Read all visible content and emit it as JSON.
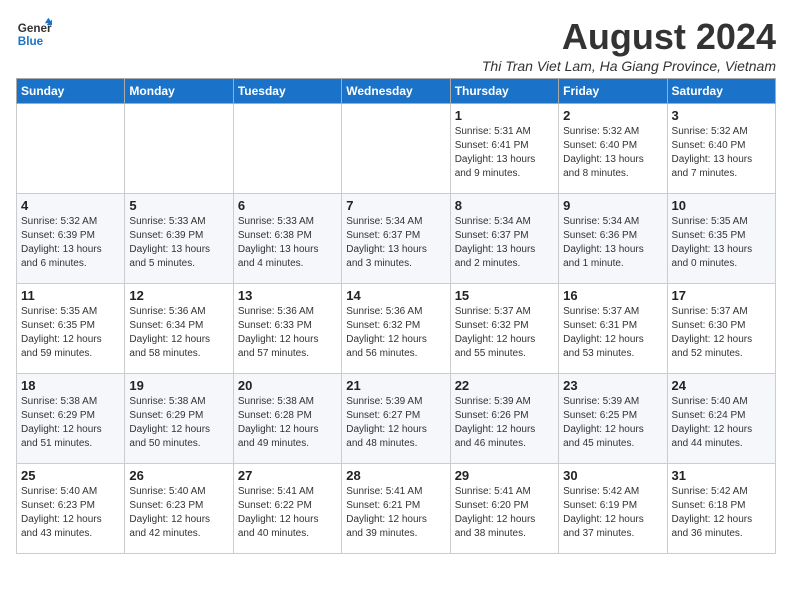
{
  "header": {
    "logo_line1": "General",
    "logo_line2": "Blue",
    "month_title": "August 2024",
    "subtitle": "Thi Tran Viet Lam, Ha Giang Province, Vietnam"
  },
  "days_of_week": [
    "Sunday",
    "Monday",
    "Tuesday",
    "Wednesday",
    "Thursday",
    "Friday",
    "Saturday"
  ],
  "weeks": [
    [
      {
        "day": "",
        "info": ""
      },
      {
        "day": "",
        "info": ""
      },
      {
        "day": "",
        "info": ""
      },
      {
        "day": "",
        "info": ""
      },
      {
        "day": "1",
        "info": "Sunrise: 5:31 AM\nSunset: 6:41 PM\nDaylight: 13 hours\nand 9 minutes."
      },
      {
        "day": "2",
        "info": "Sunrise: 5:32 AM\nSunset: 6:40 PM\nDaylight: 13 hours\nand 8 minutes."
      },
      {
        "day": "3",
        "info": "Sunrise: 5:32 AM\nSunset: 6:40 PM\nDaylight: 13 hours\nand 7 minutes."
      }
    ],
    [
      {
        "day": "4",
        "info": "Sunrise: 5:32 AM\nSunset: 6:39 PM\nDaylight: 13 hours\nand 6 minutes."
      },
      {
        "day": "5",
        "info": "Sunrise: 5:33 AM\nSunset: 6:39 PM\nDaylight: 13 hours\nand 5 minutes."
      },
      {
        "day": "6",
        "info": "Sunrise: 5:33 AM\nSunset: 6:38 PM\nDaylight: 13 hours\nand 4 minutes."
      },
      {
        "day": "7",
        "info": "Sunrise: 5:34 AM\nSunset: 6:37 PM\nDaylight: 13 hours\nand 3 minutes."
      },
      {
        "day": "8",
        "info": "Sunrise: 5:34 AM\nSunset: 6:37 PM\nDaylight: 13 hours\nand 2 minutes."
      },
      {
        "day": "9",
        "info": "Sunrise: 5:34 AM\nSunset: 6:36 PM\nDaylight: 13 hours\nand 1 minute."
      },
      {
        "day": "10",
        "info": "Sunrise: 5:35 AM\nSunset: 6:35 PM\nDaylight: 13 hours\nand 0 minutes."
      }
    ],
    [
      {
        "day": "11",
        "info": "Sunrise: 5:35 AM\nSunset: 6:35 PM\nDaylight: 12 hours\nand 59 minutes."
      },
      {
        "day": "12",
        "info": "Sunrise: 5:36 AM\nSunset: 6:34 PM\nDaylight: 12 hours\nand 58 minutes."
      },
      {
        "day": "13",
        "info": "Sunrise: 5:36 AM\nSunset: 6:33 PM\nDaylight: 12 hours\nand 57 minutes."
      },
      {
        "day": "14",
        "info": "Sunrise: 5:36 AM\nSunset: 6:32 PM\nDaylight: 12 hours\nand 56 minutes."
      },
      {
        "day": "15",
        "info": "Sunrise: 5:37 AM\nSunset: 6:32 PM\nDaylight: 12 hours\nand 55 minutes."
      },
      {
        "day": "16",
        "info": "Sunrise: 5:37 AM\nSunset: 6:31 PM\nDaylight: 12 hours\nand 53 minutes."
      },
      {
        "day": "17",
        "info": "Sunrise: 5:37 AM\nSunset: 6:30 PM\nDaylight: 12 hours\nand 52 minutes."
      }
    ],
    [
      {
        "day": "18",
        "info": "Sunrise: 5:38 AM\nSunset: 6:29 PM\nDaylight: 12 hours\nand 51 minutes."
      },
      {
        "day": "19",
        "info": "Sunrise: 5:38 AM\nSunset: 6:29 PM\nDaylight: 12 hours\nand 50 minutes."
      },
      {
        "day": "20",
        "info": "Sunrise: 5:38 AM\nSunset: 6:28 PM\nDaylight: 12 hours\nand 49 minutes."
      },
      {
        "day": "21",
        "info": "Sunrise: 5:39 AM\nSunset: 6:27 PM\nDaylight: 12 hours\nand 48 minutes."
      },
      {
        "day": "22",
        "info": "Sunrise: 5:39 AM\nSunset: 6:26 PM\nDaylight: 12 hours\nand 46 minutes."
      },
      {
        "day": "23",
        "info": "Sunrise: 5:39 AM\nSunset: 6:25 PM\nDaylight: 12 hours\nand 45 minutes."
      },
      {
        "day": "24",
        "info": "Sunrise: 5:40 AM\nSunset: 6:24 PM\nDaylight: 12 hours\nand 44 minutes."
      }
    ],
    [
      {
        "day": "25",
        "info": "Sunrise: 5:40 AM\nSunset: 6:23 PM\nDaylight: 12 hours\nand 43 minutes."
      },
      {
        "day": "26",
        "info": "Sunrise: 5:40 AM\nSunset: 6:23 PM\nDaylight: 12 hours\nand 42 minutes."
      },
      {
        "day": "27",
        "info": "Sunrise: 5:41 AM\nSunset: 6:22 PM\nDaylight: 12 hours\nand 40 minutes."
      },
      {
        "day": "28",
        "info": "Sunrise: 5:41 AM\nSunset: 6:21 PM\nDaylight: 12 hours\nand 39 minutes."
      },
      {
        "day": "29",
        "info": "Sunrise: 5:41 AM\nSunset: 6:20 PM\nDaylight: 12 hours\nand 38 minutes."
      },
      {
        "day": "30",
        "info": "Sunrise: 5:42 AM\nSunset: 6:19 PM\nDaylight: 12 hours\nand 37 minutes."
      },
      {
        "day": "31",
        "info": "Sunrise: 5:42 AM\nSunset: 6:18 PM\nDaylight: 12 hours\nand 36 minutes."
      }
    ]
  ]
}
